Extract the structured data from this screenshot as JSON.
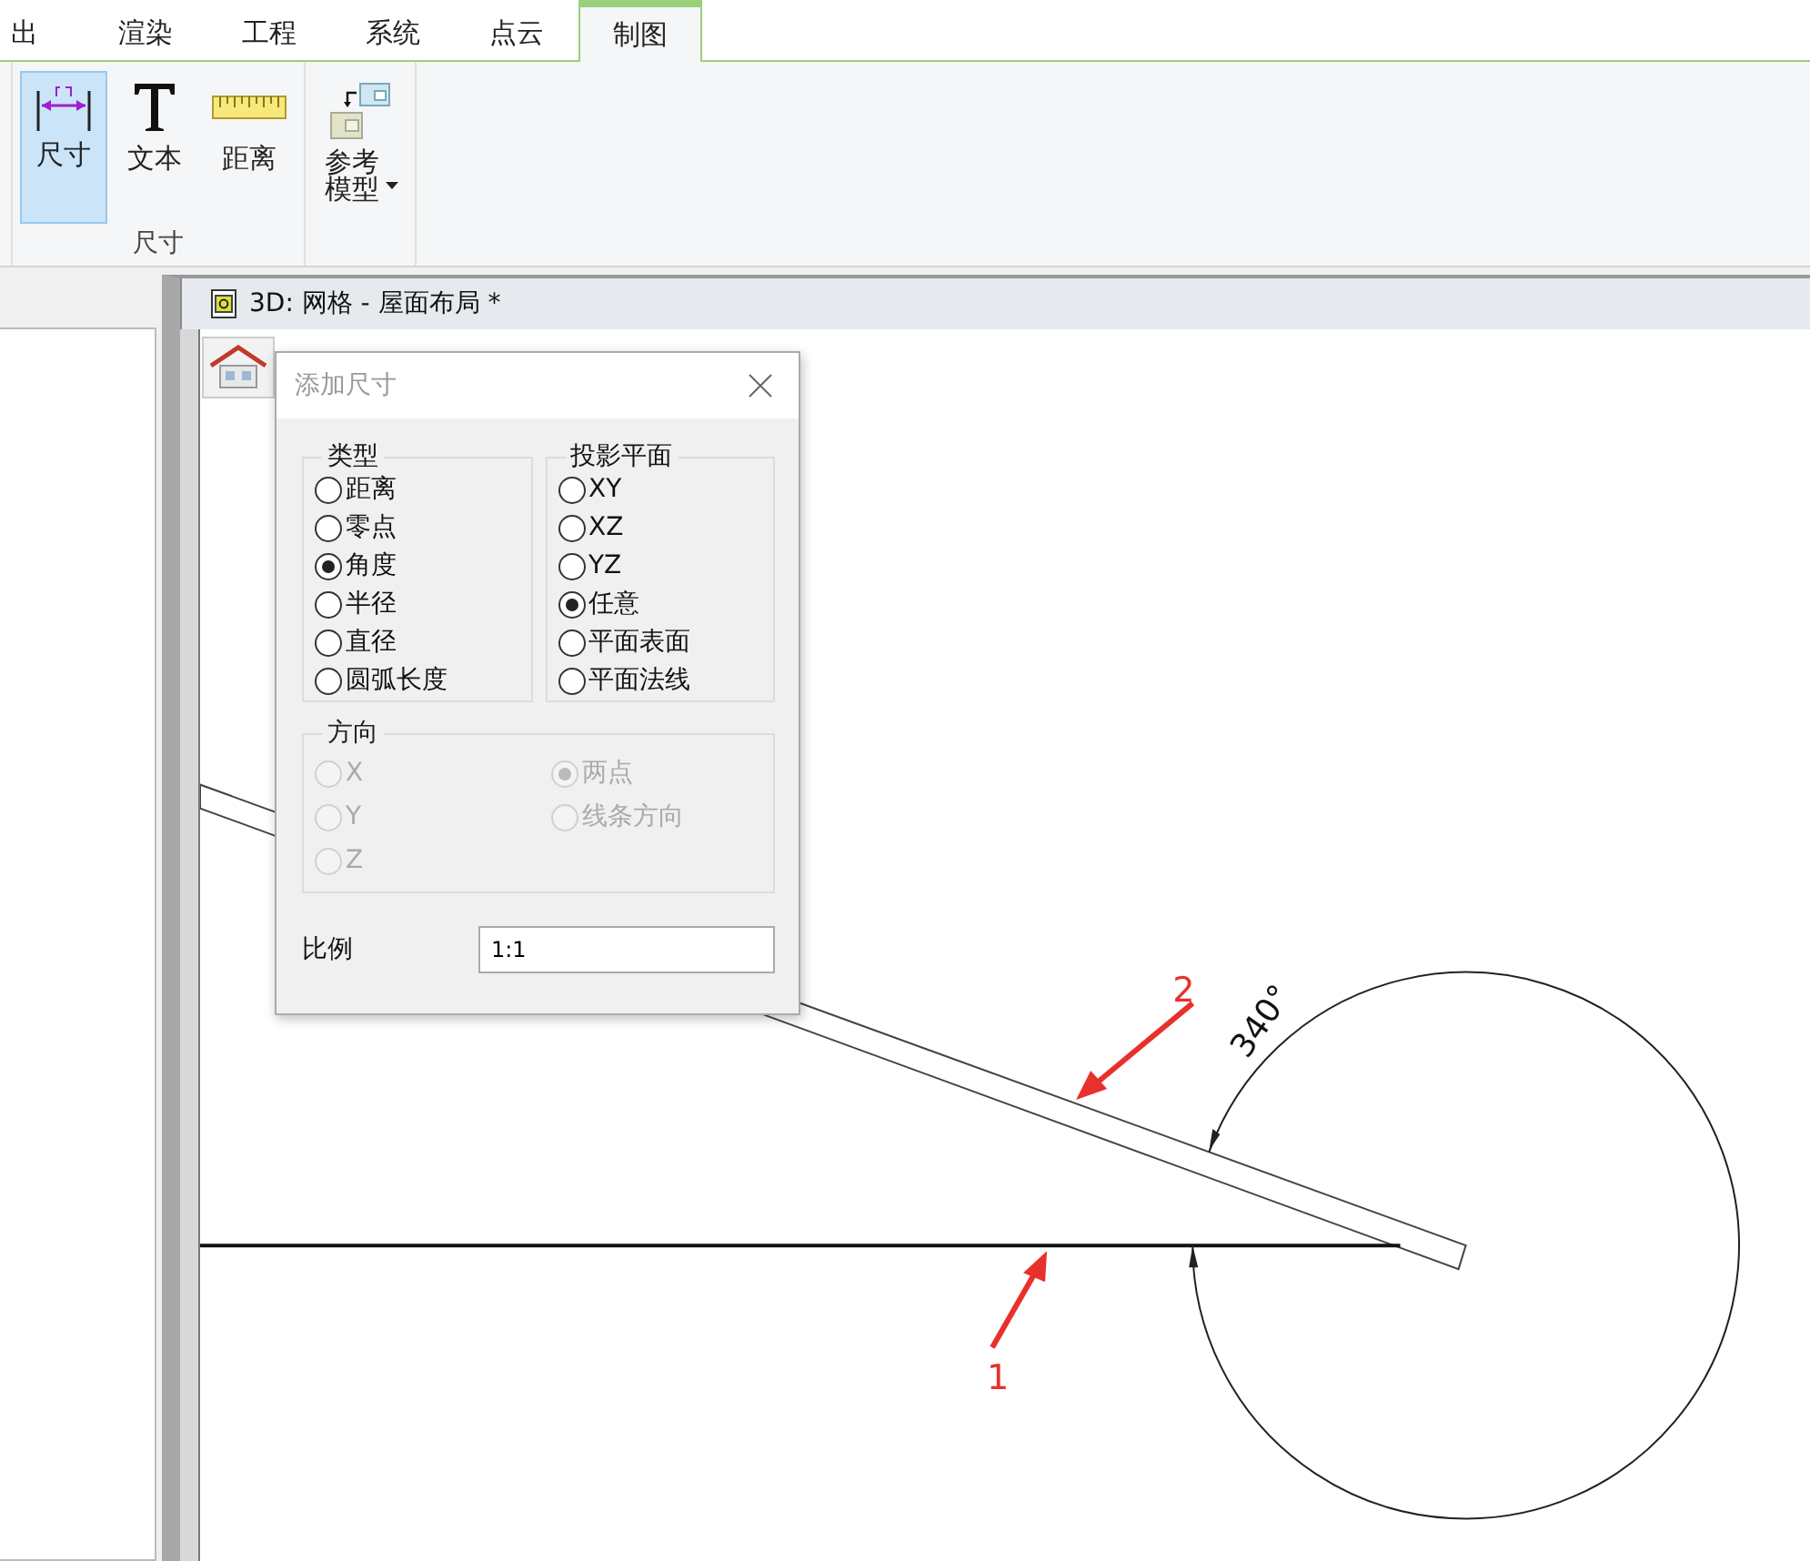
{
  "ribbon": {
    "tabs": [
      {
        "label": "出",
        "selected": false
      },
      {
        "label": "渲染",
        "selected": false
      },
      {
        "label": "工程",
        "selected": false
      },
      {
        "label": "系统",
        "selected": false
      },
      {
        "label": "点云",
        "selected": false
      },
      {
        "label": "制图",
        "selected": true
      }
    ],
    "groups": [
      {
        "label": "尺寸",
        "buttons": [
          {
            "kind": "dimension",
            "label": "尺寸",
            "selected": true
          },
          {
            "kind": "text",
            "label": "文本",
            "selected": false
          },
          {
            "kind": "distance",
            "label": "距离",
            "selected": false
          }
        ]
      },
      {
        "buttons": [
          {
            "kind": "reference",
            "label": "参考模型",
            "selected": false,
            "dropdown": true
          }
        ]
      }
    ]
  },
  "view": {
    "title": "3D: 网格 - 屋面布局 *"
  },
  "drawing": {
    "angle_label": "340°",
    "callouts": [
      {
        "label": "1"
      },
      {
        "label": "2"
      }
    ]
  },
  "dialog": {
    "title": "添加尺寸",
    "type_group": {
      "label": "类型",
      "disabled": false,
      "options": [
        {
          "label": "距离",
          "selected": false
        },
        {
          "label": "零点",
          "selected": false
        },
        {
          "label": "角度",
          "selected": true
        },
        {
          "label": "半径",
          "selected": false
        },
        {
          "label": "直径",
          "selected": false
        },
        {
          "label": "圆弧长度",
          "selected": false
        }
      ]
    },
    "plane_group": {
      "label": "投影平面",
      "disabled": false,
      "options": [
        {
          "label": "XY",
          "selected": false
        },
        {
          "label": "XZ",
          "selected": false
        },
        {
          "label": "YZ",
          "selected": false
        },
        {
          "label": "任意",
          "selected": true
        },
        {
          "label": "平面表面",
          "selected": false
        },
        {
          "label": "平面法线",
          "selected": false
        }
      ]
    },
    "direction_group": {
      "label": "方向",
      "disabled": true,
      "options": [
        {
          "label": "X",
          "selected": false
        },
        {
          "label": "两点",
          "selected": true
        },
        {
          "label": "Y",
          "selected": false
        },
        {
          "label": "线条方向",
          "selected": false
        },
        {
          "label": "Z",
          "selected": false
        }
      ]
    },
    "scale": {
      "label": "比例",
      "value": "1:1"
    }
  }
}
